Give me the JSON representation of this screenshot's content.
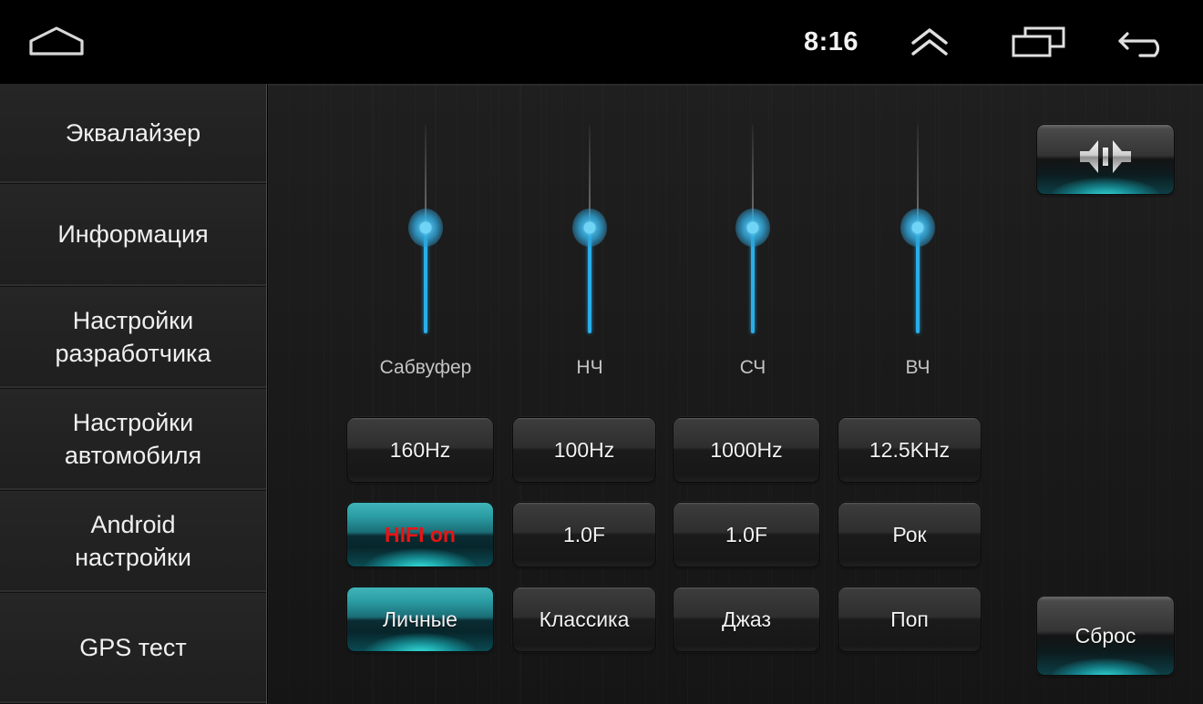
{
  "statusbar": {
    "home_icon": "home-icon",
    "time": "8:16",
    "expand_icon": "double-chevron-up-icon",
    "recents_icon": "recent-apps-icon",
    "back_icon": "back-arrow-icon"
  },
  "sidebar": {
    "items": [
      {
        "label": "Эквалайзер",
        "name": "sidebar-item-equalizer",
        "selected": true
      },
      {
        "label": "Информация",
        "name": "sidebar-item-information",
        "selected": false
      },
      {
        "label": "Настройки\nразработчика",
        "name": "sidebar-item-developer-settings",
        "selected": false
      },
      {
        "label": "Настройки\nавтомобиля",
        "name": "sidebar-item-car-settings",
        "selected": false
      },
      {
        "label": "Android\nнастройки",
        "name": "sidebar-item-android-settings",
        "selected": false
      },
      {
        "label": "GPS тест",
        "name": "sidebar-item-gps-test",
        "selected": false
      }
    ]
  },
  "equalizer": {
    "sliders": [
      {
        "label": "Сабвуфер",
        "name": "slider-subwoofer"
      },
      {
        "label": "НЧ",
        "name": "slider-bass"
      },
      {
        "label": "СЧ",
        "name": "slider-mid"
      },
      {
        "label": "ВЧ",
        "name": "slider-treble"
      }
    ],
    "rows": [
      [
        {
          "label": "160Hz",
          "name": "button-freq-160hz",
          "active": false
        },
        {
          "label": "100Hz",
          "name": "button-freq-100hz",
          "active": false
        },
        {
          "label": "1000Hz",
          "name": "button-freq-1000hz",
          "active": false
        },
        {
          "label": "12.5KHz",
          "name": "button-freq-12-5khz",
          "active": false
        }
      ],
      [
        {
          "label": "HIFI on",
          "name": "button-hifi-on",
          "active": true,
          "style": "hifi"
        },
        {
          "label": "1.0F",
          "name": "button-q-bass-1-0f",
          "active": false
        },
        {
          "label": "1.0F",
          "name": "button-q-mid-1-0f",
          "active": false
        },
        {
          "label": "Рок",
          "name": "button-preset-rock",
          "active": false
        }
      ],
      [
        {
          "label": "Личные",
          "name": "button-preset-personal",
          "active": true
        },
        {
          "label": "Классика",
          "name": "button-preset-classic",
          "active": false
        },
        {
          "label": "Джаз",
          "name": "button-preset-jazz",
          "active": false
        },
        {
          "label": "Поп",
          "name": "button-preset-pop",
          "active": false
        }
      ]
    ],
    "balance_button": {
      "name": "button-balance-fader",
      "icon": "balance-speakers-icon"
    },
    "reset_button": {
      "name": "button-reset",
      "label": "Сброс"
    }
  },
  "colors": {
    "accent_blue": "#29aee8",
    "accent_teal": "#2cd7d7",
    "hifi_red": "#e81414",
    "panel_bg": "#1b1b1b",
    "sidebar_bg": "#232323"
  }
}
